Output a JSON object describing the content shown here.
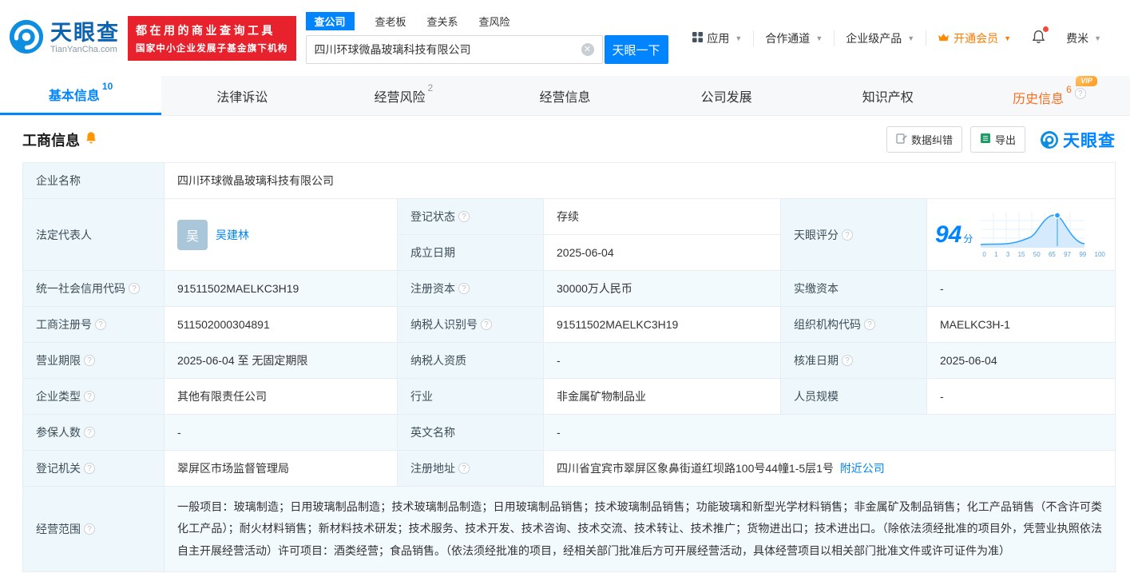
{
  "topbar": {
    "logo_brand": "天眼查",
    "logo_domain": "TianYanCha.com",
    "slogan_line1": "都在用的商业查询工具",
    "slogan_line2": "国家中小企业发展子基金旗下机构",
    "search_tabs": [
      {
        "label": "查公司"
      },
      {
        "label": "查老板"
      },
      {
        "label": "查关系"
      },
      {
        "label": "查风险"
      }
    ],
    "search_value": "四川环球微晶玻璃科技有限公司",
    "search_button": "天眼一下",
    "nav_app": "应用",
    "nav_partner": "合作通道",
    "nav_enterprise": "企业级产品",
    "nav_vip": "开通会员",
    "nav_user": "费米"
  },
  "tabs": {
    "basic": {
      "label": "基本信息",
      "count": "10"
    },
    "legal": {
      "label": "法律诉讼"
    },
    "risk": {
      "label": "经营风险",
      "count": "2"
    },
    "operation": {
      "label": "经营信息"
    },
    "development": {
      "label": "公司发展"
    },
    "ip": {
      "label": "知识产权"
    },
    "history": {
      "label": "历史信息",
      "count": "6",
      "vip": "VIP"
    }
  },
  "section": {
    "title": "工商信息",
    "btn_correction": "数据纠错",
    "btn_export": "导出",
    "watermark": "天眼查"
  },
  "info": {
    "company_name_label": "企业名称",
    "company_name": "四川环球微晶玻璃科技有限公司",
    "legal_rep_label": "法定代表人",
    "legal_rep_avatar": "吴",
    "legal_rep_name": "吴建林",
    "reg_status_label": "登记状态",
    "reg_status": "存续",
    "est_date_label": "成立日期",
    "est_date": "2025-06-04",
    "score_label": "天眼评分",
    "score": "94",
    "score_unit": "分",
    "score_axis": [
      "0",
      "1",
      "3",
      "15",
      "50",
      "65",
      "97",
      "99",
      "100"
    ],
    "credit_code_label": "统一社会信用代码",
    "credit_code": "91511502MAELKC3H19",
    "reg_capital_label": "注册资本",
    "reg_capital": "30000万人民币",
    "paid_capital_label": "实缴资本",
    "paid_capital": "-",
    "reg_number_label": "工商注册号",
    "reg_number": "511502000304891",
    "taxpayer_id_label": "纳税人识别号",
    "taxpayer_id": "91511502MAELKC3H19",
    "org_code_label": "组织机构代码",
    "org_code": "MAELKC3H-1",
    "term_label": "营业期限",
    "term": "2025-06-04 至 无固定期限",
    "taxpayer_quality_label": "纳税人资质",
    "taxpayer_quality": "-",
    "approval_date_label": "核准日期",
    "approval_date": "2025-06-04",
    "company_type_label": "企业类型",
    "company_type": "其他有限责任公司",
    "industry_label": "行业",
    "industry": "非金属矿物制品业",
    "staff_label": "人员规模",
    "staff": "-",
    "insured_label": "参保人数",
    "insured": "-",
    "english_label": "英文名称",
    "english_name": "-",
    "authority_label": "登记机关",
    "authority": "翠屏区市场监督管理局",
    "address_label": "注册地址",
    "address": "四川省宜宾市翠屏区象鼻街道红坝路100号44幢1-5层1号",
    "nearby": "附近公司",
    "scope_label": "经营范围",
    "scope": "一般项目：玻璃制造；日用玻璃制品制造；技术玻璃制品制造；日用玻璃制品销售；技术玻璃制品销售；功能玻璃和新型光学材料销售；非金属矿及制品销售；化工产品销售（不含许可类化工产品）；耐火材料销售；新材料技术研发；技术服务、技术开发、技术咨询、技术交流、技术转让、技术推广；货物进出口；技术进出口。（除依法须经批准的项目外，凭营业执照依法自主开展经营活动）许可项目：酒类经营；食品销售。（依法须经批准的项目，经相关部门批准后方可开展经营活动，具体经营项目以相关部门批准文件或许可证件为准）"
  }
}
